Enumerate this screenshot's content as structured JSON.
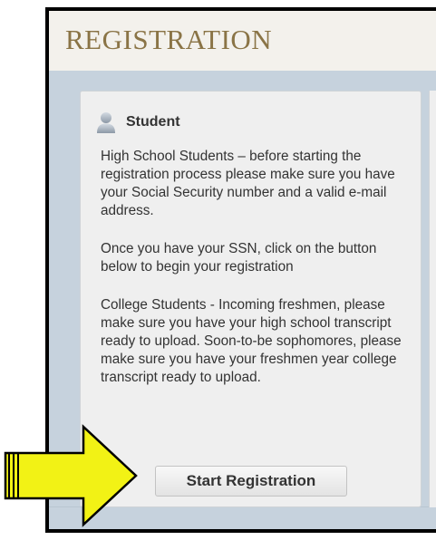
{
  "page": {
    "title": "REGISTRATION"
  },
  "card": {
    "title": "Student",
    "paragraphs": [
      "High School Students – before starting the registration process please make sure you have your Social Security number and a valid e-mail address.",
      "Once you have your SSN, click on the button below to begin your registration",
      "College Students - Incoming freshmen, please make sure you have your high school transcript ready to upload. Soon-to-be sophomores, please make sure you have your freshmen year college transcript ready to upload."
    ],
    "button_label": "Start Registration"
  },
  "icons": {
    "avatar": "user-avatar-icon",
    "arrow": "pointer-arrow-icon"
  },
  "colors": {
    "title": "#8a7446",
    "band": "#c6d2dd",
    "card": "#efefef",
    "arrow_fill": "#f2f215",
    "arrow_stroke": "#000000"
  }
}
